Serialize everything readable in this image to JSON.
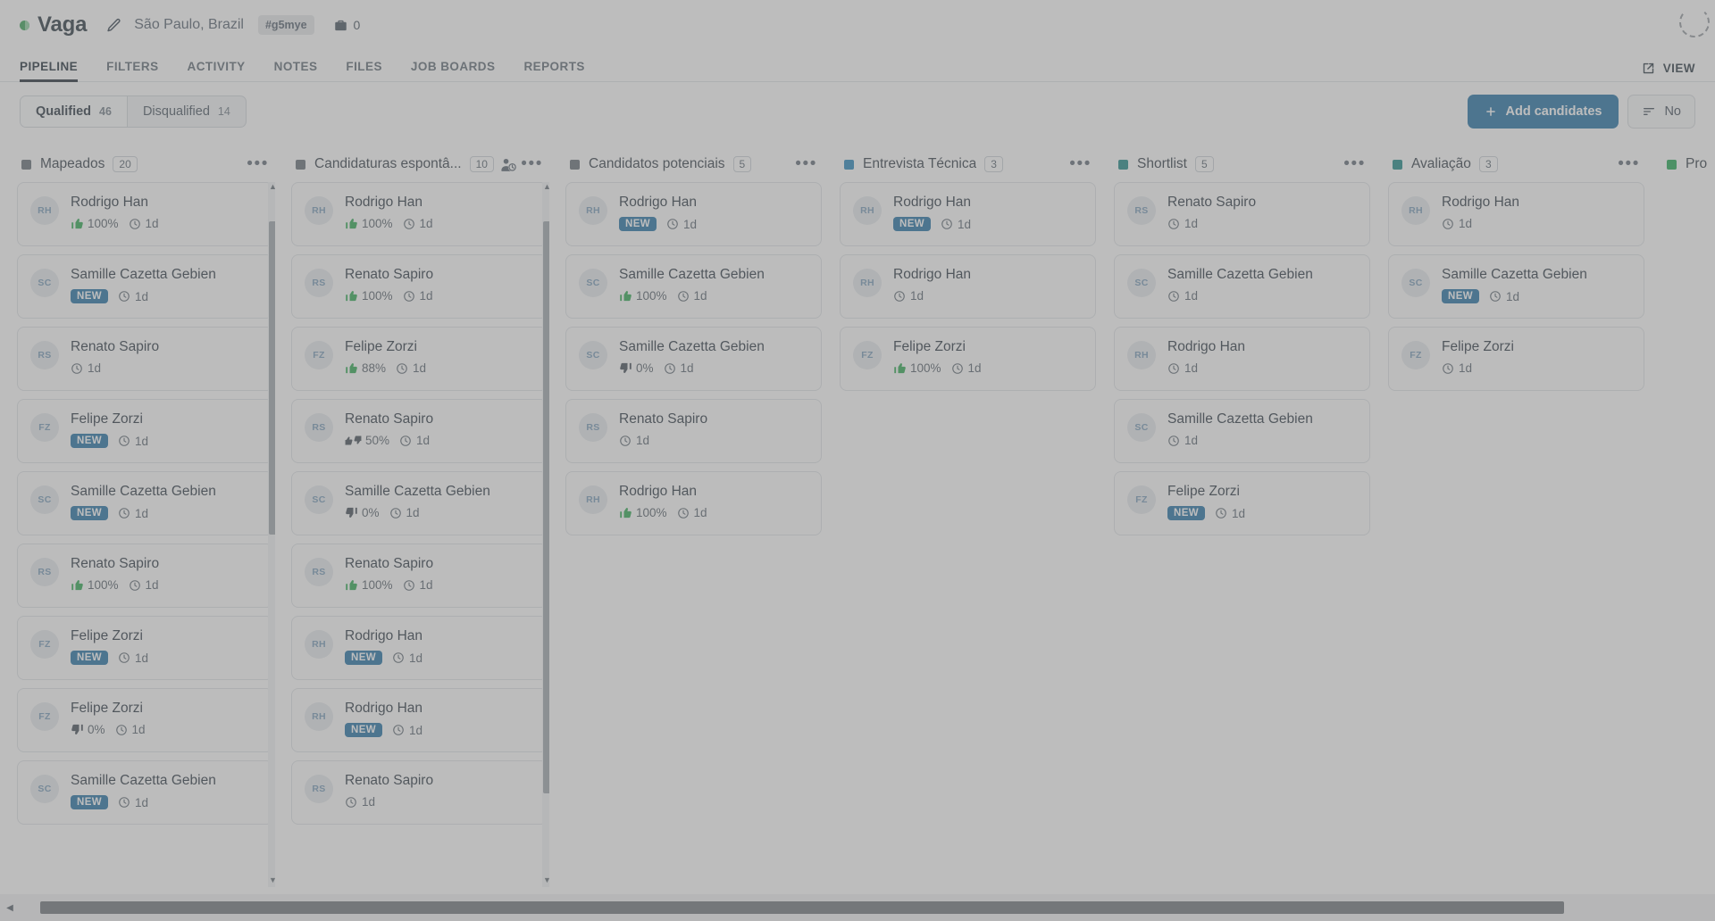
{
  "header": {
    "status_icon": "half-circle-status-icon",
    "title": "Vaga",
    "edit_icon": "pencil-icon",
    "location": "São Paulo, Brazil",
    "tag": "#g5mye",
    "briefcase_icon": "briefcase-icon",
    "openings_count": "0",
    "spinner_icon": "loading-spinner-icon"
  },
  "tabs": [
    {
      "label": "PIPELINE",
      "active": true
    },
    {
      "label": "FILTERS",
      "active": false
    },
    {
      "label": "ACTIVITY",
      "active": false
    },
    {
      "label": "NOTES",
      "active": false
    },
    {
      "label": "FILES",
      "active": false
    },
    {
      "label": "JOB BOARDS",
      "active": false
    },
    {
      "label": "REPORTS",
      "active": false
    }
  ],
  "view_button": {
    "label": "VIEW",
    "icon": "external-link-icon"
  },
  "toolbar": {
    "segments": [
      {
        "label": "Qualified",
        "count": "46",
        "active": true
      },
      {
        "label": "Disqualified",
        "count": "14",
        "active": false
      }
    ],
    "add_candidates": {
      "label": "Add candidates",
      "icon": "plus-icon"
    },
    "sort": {
      "label": "No",
      "icon": "sort-icon"
    }
  },
  "colors": {
    "accent_blue": "#1569a0",
    "marker_gray": "#5c666f",
    "marker_blue": "#1d7fb8",
    "marker_teal": "#11837f",
    "marker_green": "#16a34a",
    "positive_green": "#22a447",
    "negative_dark": "#3a444e"
  },
  "board": {
    "columns": [
      {
        "title": "Mapeados",
        "count": "20",
        "marker": "gray",
        "has_auto_icon": false,
        "menu_icon": "more-options-icon",
        "scrollbar": {
          "visible": true,
          "thumb_top_pct": 4,
          "thumb_height_pct": 46
        },
        "cards": [
          {
            "initials": "RH",
            "name": "Rodrigo Han",
            "rating_type": "positive",
            "rating": "100%",
            "time": "1d"
          },
          {
            "initials": "SC",
            "name": "Samille Cazetta Gebien",
            "rating_type": "new",
            "rating": "NEW",
            "time": "1d"
          },
          {
            "initials": "RS",
            "name": "Renato Sapiro",
            "rating_type": "none",
            "rating": "",
            "time": "1d"
          },
          {
            "initials": "FZ",
            "name": "Felipe Zorzi",
            "rating_type": "new",
            "rating": "NEW",
            "time": "1d"
          },
          {
            "initials": "SC",
            "name": "Samille Cazetta Gebien",
            "rating_type": "new",
            "rating": "NEW",
            "time": "1d"
          },
          {
            "initials": "RS",
            "name": "Renato Sapiro",
            "rating_type": "positive",
            "rating": "100%",
            "time": "1d"
          },
          {
            "initials": "FZ",
            "name": "Felipe Zorzi",
            "rating_type": "new",
            "rating": "NEW",
            "time": "1d"
          },
          {
            "initials": "FZ",
            "name": "Felipe Zorzi",
            "rating_type": "negative",
            "rating": "0%",
            "time": "1d"
          },
          {
            "initials": "SC",
            "name": "Samille Cazetta Gebien",
            "rating_type": "new",
            "rating": "NEW",
            "time": "1d"
          }
        ]
      },
      {
        "title": "Candidaturas espontâ...",
        "count": "10",
        "marker": "gray",
        "has_auto_icon": true,
        "auto_icon": "user-clock-icon",
        "menu_icon": "more-options-icon",
        "scrollbar": {
          "visible": true,
          "thumb_top_pct": 4,
          "thumb_height_pct": 84
        },
        "cards": [
          {
            "initials": "RH",
            "name": "Rodrigo Han",
            "rating_type": "positive",
            "rating": "100%",
            "time": "1d"
          },
          {
            "initials": "RS",
            "name": "Renato Sapiro",
            "rating_type": "positive",
            "rating": "100%",
            "time": "1d"
          },
          {
            "initials": "FZ",
            "name": "Felipe Zorzi",
            "rating_type": "positive",
            "rating": "88%",
            "time": "1d"
          },
          {
            "initials": "RS",
            "name": "Renato Sapiro",
            "rating_type": "mixed",
            "rating": "50%",
            "time": "1d"
          },
          {
            "initials": "SC",
            "name": "Samille Cazetta Gebien",
            "rating_type": "negative",
            "rating": "0%",
            "time": "1d"
          },
          {
            "initials": "RS",
            "name": "Renato Sapiro",
            "rating_type": "positive",
            "rating": "100%",
            "time": "1d"
          },
          {
            "initials": "RH",
            "name": "Rodrigo Han",
            "rating_type": "new",
            "rating": "NEW",
            "time": "1d"
          },
          {
            "initials": "RH",
            "name": "Rodrigo Han",
            "rating_type": "new",
            "rating": "NEW",
            "time": "1d"
          },
          {
            "initials": "RS",
            "name": "Renato Sapiro",
            "rating_type": "none",
            "rating": "",
            "time": "1d"
          }
        ]
      },
      {
        "title": "Candidatos potenciais",
        "count": "5",
        "marker": "gray",
        "has_auto_icon": false,
        "menu_icon": "more-options-icon",
        "scrollbar": {
          "visible": false,
          "thumb_top_pct": 0,
          "thumb_height_pct": 0
        },
        "cards": [
          {
            "initials": "RH",
            "name": "Rodrigo Han",
            "rating_type": "new",
            "rating": "NEW",
            "time": "1d"
          },
          {
            "initials": "SC",
            "name": "Samille Cazetta Gebien",
            "rating_type": "positive",
            "rating": "100%",
            "time": "1d"
          },
          {
            "initials": "SC",
            "name": "Samille Cazetta Gebien",
            "rating_type": "negative",
            "rating": "0%",
            "time": "1d"
          },
          {
            "initials": "RS",
            "name": "Renato Sapiro",
            "rating_type": "none",
            "rating": "",
            "time": "1d"
          },
          {
            "initials": "RH",
            "name": "Rodrigo Han",
            "rating_type": "positive",
            "rating": "100%",
            "time": "1d"
          }
        ]
      },
      {
        "title": "Entrevista Técnica",
        "count": "3",
        "marker": "blue",
        "has_auto_icon": false,
        "menu_icon": "more-options-icon",
        "scrollbar": {
          "visible": false,
          "thumb_top_pct": 0,
          "thumb_height_pct": 0
        },
        "cards": [
          {
            "initials": "RH",
            "name": "Rodrigo Han",
            "rating_type": "new",
            "rating": "NEW",
            "time": "1d"
          },
          {
            "initials": "RH",
            "name": "Rodrigo Han",
            "rating_type": "none",
            "rating": "",
            "time": "1d"
          },
          {
            "initials": "FZ",
            "name": "Felipe Zorzi",
            "rating_type": "positive",
            "rating": "100%",
            "time": "1d"
          }
        ]
      },
      {
        "title": "Shortlist",
        "count": "5",
        "marker": "teal",
        "has_auto_icon": false,
        "menu_icon": "more-options-icon",
        "scrollbar": {
          "visible": false,
          "thumb_top_pct": 0,
          "thumb_height_pct": 0
        },
        "cards": [
          {
            "initials": "RS",
            "name": "Renato Sapiro",
            "rating_type": "none",
            "rating": "",
            "time": "1d"
          },
          {
            "initials": "SC",
            "name": "Samille Cazetta Gebien",
            "rating_type": "none",
            "rating": "",
            "time": "1d"
          },
          {
            "initials": "RH",
            "name": "Rodrigo Han",
            "rating_type": "none",
            "rating": "",
            "time": "1d"
          },
          {
            "initials": "SC",
            "name": "Samille Cazetta Gebien",
            "rating_type": "none",
            "rating": "",
            "time": "1d"
          },
          {
            "initials": "FZ",
            "name": "Felipe Zorzi",
            "rating_type": "new",
            "rating": "NEW",
            "time": "1d"
          }
        ]
      },
      {
        "title": "Avaliação",
        "count": "3",
        "marker": "teal",
        "has_auto_icon": false,
        "menu_icon": "more-options-icon",
        "scrollbar": {
          "visible": false,
          "thumb_top_pct": 0,
          "thumb_height_pct": 0
        },
        "cards": [
          {
            "initials": "RH",
            "name": "Rodrigo Han",
            "rating_type": "none",
            "rating": "",
            "time": "1d"
          },
          {
            "initials": "SC",
            "name": "Samille Cazetta Gebien",
            "rating_type": "new",
            "rating": "NEW",
            "time": "1d"
          },
          {
            "initials": "FZ",
            "name": "Felipe Zorzi",
            "rating_type": "none",
            "rating": "",
            "time": "1d"
          }
        ]
      },
      {
        "title": "Pro",
        "count": "",
        "marker": "green",
        "has_auto_icon": false,
        "menu_icon": "more-options-icon",
        "scrollbar": {
          "visible": false,
          "thumb_top_pct": 0,
          "thumb_height_pct": 0
        },
        "cards": []
      }
    ]
  },
  "h_scrollbar": {
    "thumb_left_pct": 1.2,
    "thumb_width_pct": 90
  }
}
